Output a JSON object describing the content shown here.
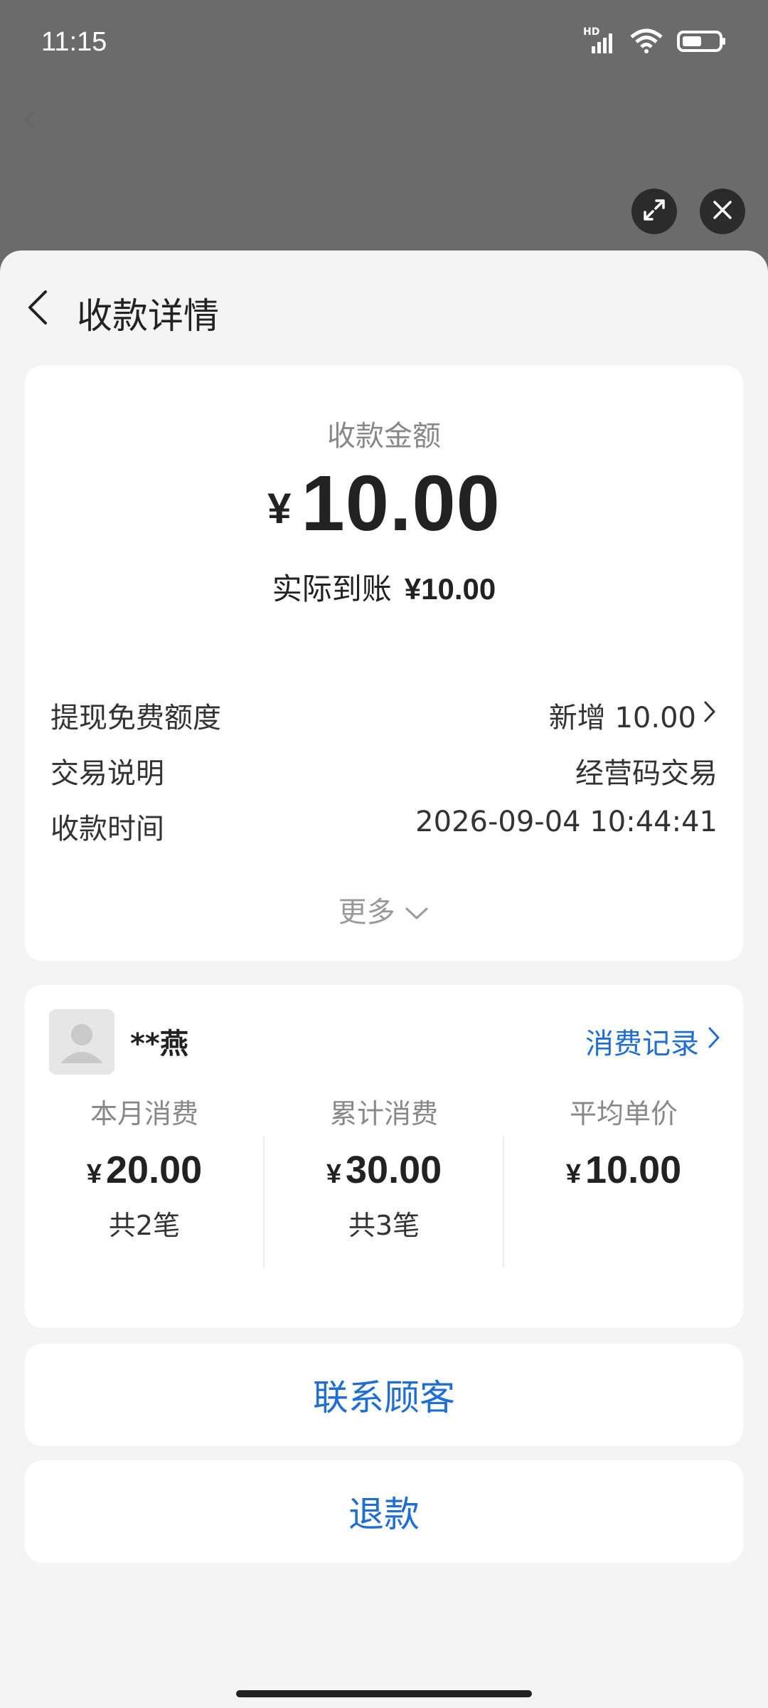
{
  "status": {
    "time": "11:15",
    "network_label": "HD"
  },
  "nav": {
    "title": "收款详情"
  },
  "amount": {
    "label": "收款金额",
    "currency": "¥",
    "value": "10.00",
    "actual_label": "实际到账",
    "actual_value": "¥10.00"
  },
  "details": [
    {
      "label": "提现免费额度",
      "value": "新增 10.00",
      "has_arrow": true
    },
    {
      "label": "交易说明",
      "value": "经营码交易",
      "has_arrow": false
    },
    {
      "label": "收款时间",
      "value": "2026-09-04 10:44:41",
      "has_arrow": false
    }
  ],
  "more_label": "更多",
  "customer": {
    "name": "**燕",
    "records_link": "消费记录",
    "stats": [
      {
        "title": "本月消费",
        "currency": "¥",
        "value": "20.00",
        "count": "共2笔"
      },
      {
        "title": "累计消费",
        "currency": "¥",
        "value": "30.00",
        "count": "共3笔"
      },
      {
        "title": "平均单价",
        "currency": "¥",
        "value": "10.00",
        "count": ""
      }
    ]
  },
  "actions": {
    "contact": "联系顾客",
    "refund": "退款"
  },
  "colors": {
    "accent": "#1f6ed4",
    "overlay": "#6b6b6b",
    "sheet_bg": "#f4f4f4"
  }
}
